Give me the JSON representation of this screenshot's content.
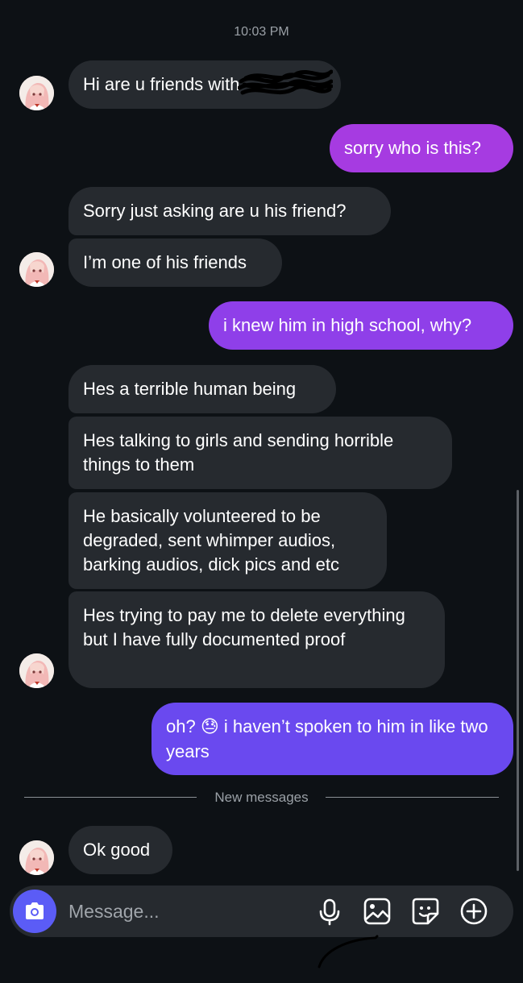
{
  "header": {
    "timestamp": "10:03 PM"
  },
  "messages": [
    {
      "side": "in",
      "text": "Hi are u friends with"
    },
    {
      "side": "out",
      "text": "sorry who is this?"
    },
    {
      "side": "in",
      "text": "Sorry just asking are u his friend?"
    },
    {
      "side": "in",
      "text": "I’m one of his friends"
    },
    {
      "side": "out",
      "text": "i knew him in high school, why?"
    },
    {
      "side": "in",
      "text": "Hes a terrible human being"
    },
    {
      "side": "in",
      "text": "Hes talking to girls and sending horrible things to them"
    },
    {
      "side": "in",
      "text": "He basically volunteered to be degraded, sent whimper audios, barking audios, dick pics and etc"
    },
    {
      "side": "in",
      "text": "Hes trying to pay me to delete everything but I have fully documented proof"
    },
    {
      "side": "out",
      "text_before_emoji": "oh?",
      "emoji": "😓",
      "text_after_emoji": "i haven’t spoken to him in like two years"
    },
    {
      "side": "in",
      "text": "Ok good"
    }
  ],
  "divider": {
    "label": "New messages"
  },
  "composer": {
    "placeholder": "Message...",
    "value": "",
    "icons": [
      "camera-icon",
      "microphone-icon",
      "gallery-icon",
      "sticker-icon",
      "plus-icon"
    ]
  },
  "colors": {
    "background": "#0d1115",
    "incoming_bubble": "#262a2f",
    "outgoing_gradient_top": "#a53be0",
    "outgoing_gradient_bottom": "#5b4cf0",
    "camera_button": "#5b5cf6"
  }
}
